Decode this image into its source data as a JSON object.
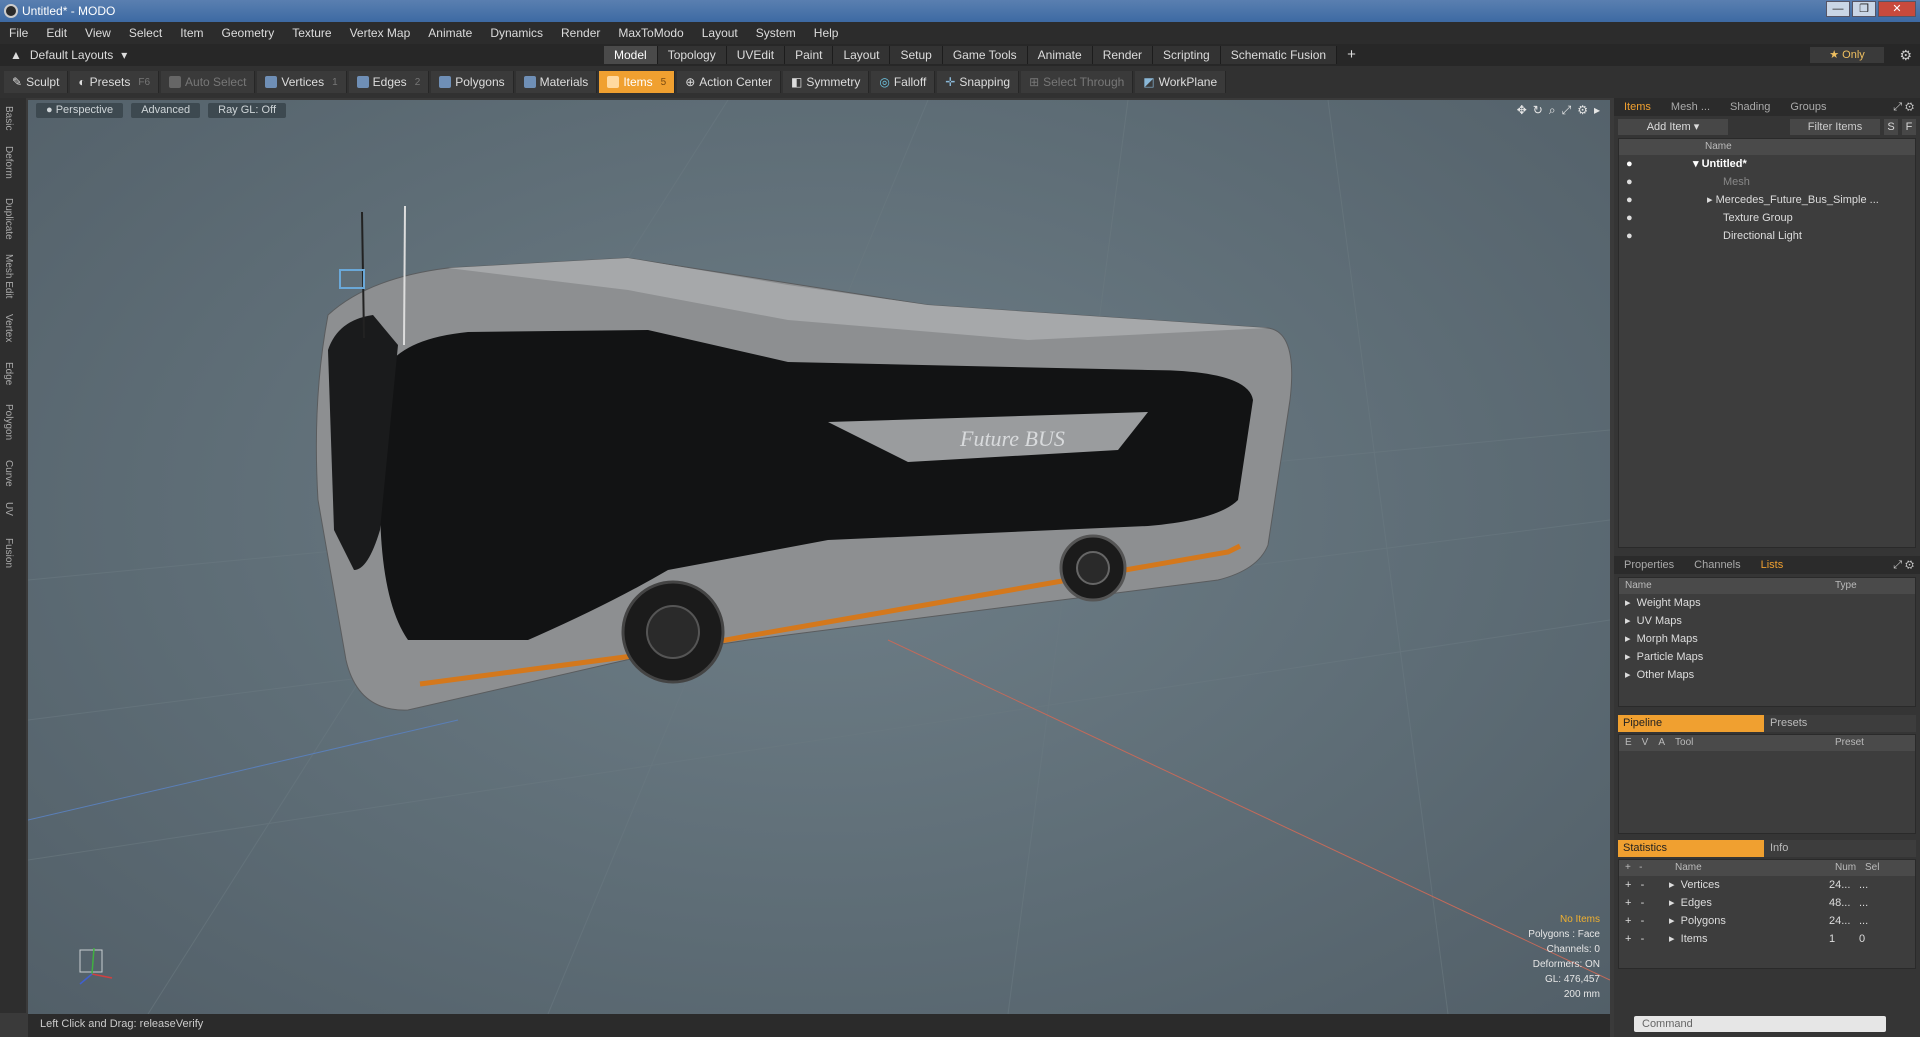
{
  "window": {
    "title": "Untitled* - MODO",
    "controls": [
      "—",
      "❐",
      "✕"
    ]
  },
  "menu": [
    "File",
    "Edit",
    "View",
    "Select",
    "Item",
    "Geometry",
    "Texture",
    "Vertex Map",
    "Animate",
    "Dynamics",
    "Render",
    "MaxToModo",
    "Layout",
    "System",
    "Help"
  ],
  "layout_selector": "Default Layouts",
  "tabs": [
    "Model",
    "Topology",
    "UVEdit",
    "Paint",
    "Layout",
    "Setup",
    "Game Tools",
    "Animate",
    "Render",
    "Scripting",
    "Schematic Fusion"
  ],
  "tabs_add": "+",
  "only_label": "Only",
  "toolbar": {
    "sculpt": "Sculpt",
    "presets": "Presets",
    "presets_key": "F6",
    "auto_select": "Auto Select",
    "vertices": "Vertices",
    "vertices_key": "1",
    "edges": "Edges",
    "edges_key": "2",
    "polygons": "Polygons",
    "materials": "Materials",
    "items": "Items",
    "items_key": "5",
    "action_center": "Action Center",
    "symmetry": "Symmetry",
    "falloff": "Falloff",
    "snapping": "Snapping",
    "select_through": "Select Through",
    "workplane": "WorkPlane"
  },
  "left_tabs": [
    "Basic",
    "Deform",
    "Duplicate",
    "Mesh Edit",
    "Vertex",
    "Edge",
    "Polygon",
    "Curve",
    "UV",
    "Fusion"
  ],
  "viewport": {
    "view": "Perspective",
    "advanced": "Advanced",
    "raygl": "Ray GL: Off",
    "bus_text": "Future BUS",
    "info": {
      "no_items": "No Items",
      "polygons": "Polygons : Face",
      "channels": "Channels: 0",
      "deformers": "Deformers: ON",
      "gl": "GL: 476,457",
      "scale": "200 mm"
    }
  },
  "status": {
    "hint": "Left Click and Drag:",
    "action": "releaseVerify"
  },
  "items_panel": {
    "tabs": [
      "Items",
      "Mesh ...",
      "Shading",
      "Groups"
    ],
    "add_item": "Add Item",
    "filter": "Filter Items",
    "s": "S",
    "f": "F",
    "col_name": "Name",
    "tree": [
      {
        "label": "Untitled*"
      },
      {
        "label": "Mesh"
      },
      {
        "label": "Mercedes_Future_Bus_Simple ..."
      },
      {
        "label": "Texture Group"
      },
      {
        "label": "Directional Light"
      }
    ]
  },
  "props_panel": {
    "tabs": [
      "Properties",
      "Channels",
      "Lists"
    ],
    "col_name": "Name",
    "col_type": "Type",
    "lists": [
      "Weight Maps",
      "UV Maps",
      "Morph Maps",
      "Particle Maps",
      "Other Maps"
    ]
  },
  "pipeline": {
    "tab_a": "Pipeline",
    "tab_b": "Presets",
    "cols": [
      "E",
      "V",
      "A",
      "Tool",
      "Preset"
    ]
  },
  "stats": {
    "tab_a": "Statistics",
    "tab_b": "Info",
    "cols": [
      "Name",
      "Num",
      "Sel"
    ],
    "rows": [
      {
        "name": "Vertices",
        "num": "24...",
        "sel": "..."
      },
      {
        "name": "Edges",
        "num": "48...",
        "sel": "..."
      },
      {
        "name": "Polygons",
        "num": "24...",
        "sel": "..."
      },
      {
        "name": "Items",
        "num": "1",
        "sel": "0"
      }
    ]
  },
  "command_placeholder": "Command"
}
